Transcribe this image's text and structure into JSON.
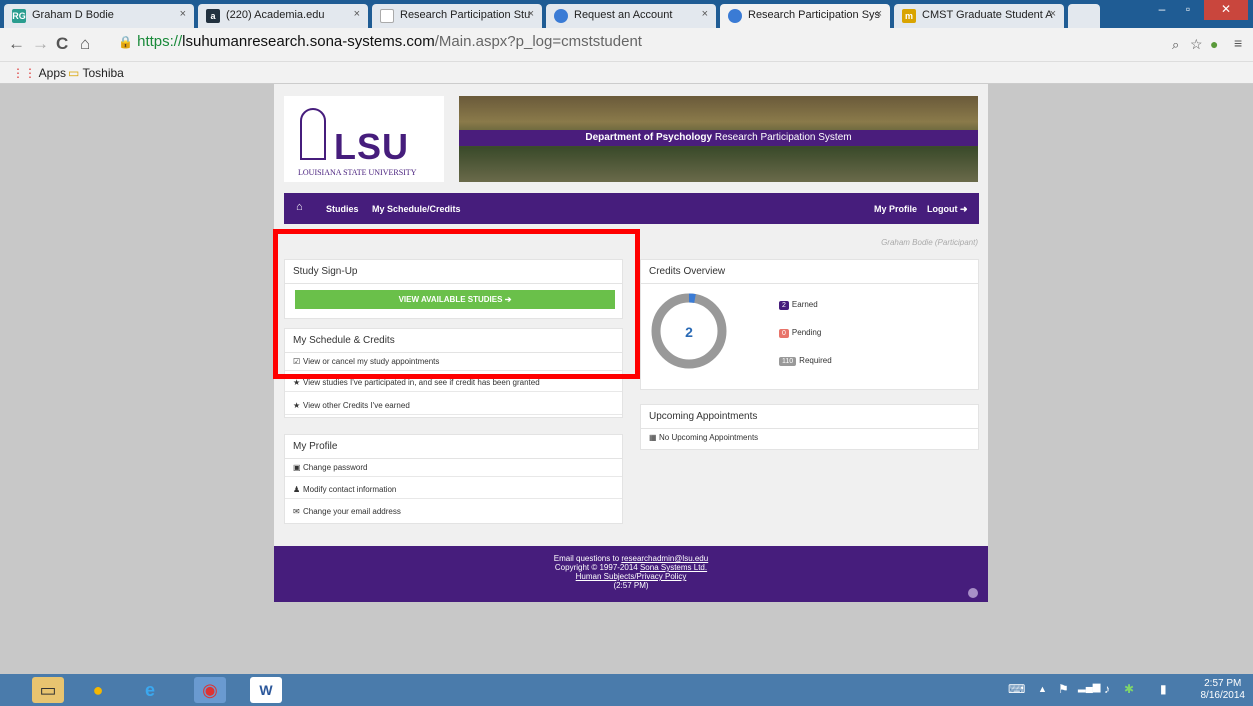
{
  "browser": {
    "tabs": [
      {
        "label": "Graham D Bodie",
        "icon": "RG",
        "icon_color": "#2a9d8f"
      },
      {
        "label": "(220) Academia.edu",
        "icon": "a",
        "icon_color": "#22313f"
      },
      {
        "label": "Research Participation Stu",
        "icon": "doc",
        "icon_color": "#888888"
      },
      {
        "label": "Request an Account",
        "icon": "sona",
        "icon_color": "#3a7bd5"
      },
      {
        "label": "Research Participation Sys",
        "icon": "sona",
        "icon_color": "#3a7bd5"
      },
      {
        "label": "CMST Graduate Student A",
        "icon": "m",
        "icon_color": "#d9a400"
      }
    ],
    "url": {
      "scheme": "https://",
      "host": "lsuhumanresearch.sona-systems.com",
      "path": "/Main.aspx?p_log=cmststudent"
    },
    "bookmarks": {
      "apps": "Apps",
      "folder": "Toshiba"
    }
  },
  "site": {
    "logo_text": "LSU",
    "logo_subtitle": "LOUISIANA STATE UNIVERSITY",
    "banner_bold": "Department of Psychology",
    "banner_rest": " Research Participation System",
    "nav": {
      "studies": "Studies",
      "schedule": "My Schedule/Credits",
      "profile": "My Profile",
      "logout": "Logout"
    },
    "user": "Graham Bodie (Participant)"
  },
  "signup": {
    "title": "Study Sign-Up",
    "button": "VIEW AVAILABLE STUDIES"
  },
  "schedule": {
    "title": "My Schedule & Credits",
    "items": [
      "View or cancel my study appointments",
      "View studies I've participated in, and see if credit has been granted",
      "View other Credits I've earned"
    ]
  },
  "profile": {
    "title": "My Profile",
    "items": [
      "Change password",
      "Modify contact information",
      "Change your email address"
    ]
  },
  "credits": {
    "title": "Credits Overview",
    "ring_value": "2",
    "earned_val": "2",
    "earned_label": "Earned",
    "pending_val": "0",
    "pending_label": "Pending",
    "required_val": "110",
    "required_label": "Required",
    "earned_color": "#461d7c",
    "pending_color": "#e8746a",
    "required_color": "#999999"
  },
  "appointments": {
    "title": "Upcoming Appointments",
    "empty": "No Upcoming Appointments"
  },
  "footer": {
    "line1_text": "Email questions to ",
    "email": "researchadmin@lsu.edu",
    "line2_text": "Copyright © 1997-2014 ",
    "company": "Sona Systems Ltd.",
    "policy": "Human Subjects/Privacy Policy",
    "time": "(2:57 PM)"
  },
  "taskbar": {
    "time": "2:57 PM",
    "date": "8/16/2014"
  }
}
